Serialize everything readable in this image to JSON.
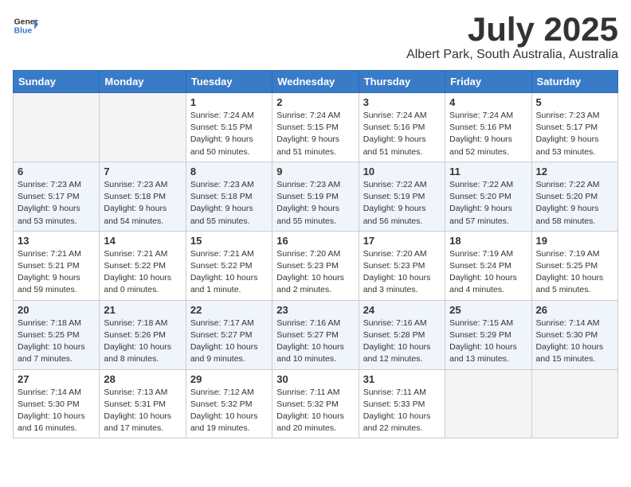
{
  "header": {
    "logo_general": "General",
    "logo_blue": "Blue",
    "month": "July 2025",
    "location": "Albert Park, South Australia, Australia"
  },
  "days_of_week": [
    "Sunday",
    "Monday",
    "Tuesday",
    "Wednesday",
    "Thursday",
    "Friday",
    "Saturday"
  ],
  "weeks": [
    [
      {
        "day": "",
        "sunrise": "",
        "sunset": "",
        "daylight": ""
      },
      {
        "day": "",
        "sunrise": "",
        "sunset": "",
        "daylight": ""
      },
      {
        "day": "1",
        "sunrise": "Sunrise: 7:24 AM",
        "sunset": "Sunset: 5:15 PM",
        "daylight": "Daylight: 9 hours and 50 minutes."
      },
      {
        "day": "2",
        "sunrise": "Sunrise: 7:24 AM",
        "sunset": "Sunset: 5:15 PM",
        "daylight": "Daylight: 9 hours and 51 minutes."
      },
      {
        "day": "3",
        "sunrise": "Sunrise: 7:24 AM",
        "sunset": "Sunset: 5:16 PM",
        "daylight": "Daylight: 9 hours and 51 minutes."
      },
      {
        "day": "4",
        "sunrise": "Sunrise: 7:24 AM",
        "sunset": "Sunset: 5:16 PM",
        "daylight": "Daylight: 9 hours and 52 minutes."
      },
      {
        "day": "5",
        "sunrise": "Sunrise: 7:23 AM",
        "sunset": "Sunset: 5:17 PM",
        "daylight": "Daylight: 9 hours and 53 minutes."
      }
    ],
    [
      {
        "day": "6",
        "sunrise": "Sunrise: 7:23 AM",
        "sunset": "Sunset: 5:17 PM",
        "daylight": "Daylight: 9 hours and 53 minutes."
      },
      {
        "day": "7",
        "sunrise": "Sunrise: 7:23 AM",
        "sunset": "Sunset: 5:18 PM",
        "daylight": "Daylight: 9 hours and 54 minutes."
      },
      {
        "day": "8",
        "sunrise": "Sunrise: 7:23 AM",
        "sunset": "Sunset: 5:18 PM",
        "daylight": "Daylight: 9 hours and 55 minutes."
      },
      {
        "day": "9",
        "sunrise": "Sunrise: 7:23 AM",
        "sunset": "Sunset: 5:19 PM",
        "daylight": "Daylight: 9 hours and 55 minutes."
      },
      {
        "day": "10",
        "sunrise": "Sunrise: 7:22 AM",
        "sunset": "Sunset: 5:19 PM",
        "daylight": "Daylight: 9 hours and 56 minutes."
      },
      {
        "day": "11",
        "sunrise": "Sunrise: 7:22 AM",
        "sunset": "Sunset: 5:20 PM",
        "daylight": "Daylight: 9 hours and 57 minutes."
      },
      {
        "day": "12",
        "sunrise": "Sunrise: 7:22 AM",
        "sunset": "Sunset: 5:20 PM",
        "daylight": "Daylight: 9 hours and 58 minutes."
      }
    ],
    [
      {
        "day": "13",
        "sunrise": "Sunrise: 7:21 AM",
        "sunset": "Sunset: 5:21 PM",
        "daylight": "Daylight: 9 hours and 59 minutes."
      },
      {
        "day": "14",
        "sunrise": "Sunrise: 7:21 AM",
        "sunset": "Sunset: 5:22 PM",
        "daylight": "Daylight: 10 hours and 0 minutes."
      },
      {
        "day": "15",
        "sunrise": "Sunrise: 7:21 AM",
        "sunset": "Sunset: 5:22 PM",
        "daylight": "Daylight: 10 hours and 1 minute."
      },
      {
        "day": "16",
        "sunrise": "Sunrise: 7:20 AM",
        "sunset": "Sunset: 5:23 PM",
        "daylight": "Daylight: 10 hours and 2 minutes."
      },
      {
        "day": "17",
        "sunrise": "Sunrise: 7:20 AM",
        "sunset": "Sunset: 5:23 PM",
        "daylight": "Daylight: 10 hours and 3 minutes."
      },
      {
        "day": "18",
        "sunrise": "Sunrise: 7:19 AM",
        "sunset": "Sunset: 5:24 PM",
        "daylight": "Daylight: 10 hours and 4 minutes."
      },
      {
        "day": "19",
        "sunrise": "Sunrise: 7:19 AM",
        "sunset": "Sunset: 5:25 PM",
        "daylight": "Daylight: 10 hours and 5 minutes."
      }
    ],
    [
      {
        "day": "20",
        "sunrise": "Sunrise: 7:18 AM",
        "sunset": "Sunset: 5:25 PM",
        "daylight": "Daylight: 10 hours and 7 minutes."
      },
      {
        "day": "21",
        "sunrise": "Sunrise: 7:18 AM",
        "sunset": "Sunset: 5:26 PM",
        "daylight": "Daylight: 10 hours and 8 minutes."
      },
      {
        "day": "22",
        "sunrise": "Sunrise: 7:17 AM",
        "sunset": "Sunset: 5:27 PM",
        "daylight": "Daylight: 10 hours and 9 minutes."
      },
      {
        "day": "23",
        "sunrise": "Sunrise: 7:16 AM",
        "sunset": "Sunset: 5:27 PM",
        "daylight": "Daylight: 10 hours and 10 minutes."
      },
      {
        "day": "24",
        "sunrise": "Sunrise: 7:16 AM",
        "sunset": "Sunset: 5:28 PM",
        "daylight": "Daylight: 10 hours and 12 minutes."
      },
      {
        "day": "25",
        "sunrise": "Sunrise: 7:15 AM",
        "sunset": "Sunset: 5:29 PM",
        "daylight": "Daylight: 10 hours and 13 minutes."
      },
      {
        "day": "26",
        "sunrise": "Sunrise: 7:14 AM",
        "sunset": "Sunset: 5:30 PM",
        "daylight": "Daylight: 10 hours and 15 minutes."
      }
    ],
    [
      {
        "day": "27",
        "sunrise": "Sunrise: 7:14 AM",
        "sunset": "Sunset: 5:30 PM",
        "daylight": "Daylight: 10 hours and 16 minutes."
      },
      {
        "day": "28",
        "sunrise": "Sunrise: 7:13 AM",
        "sunset": "Sunset: 5:31 PM",
        "daylight": "Daylight: 10 hours and 17 minutes."
      },
      {
        "day": "29",
        "sunrise": "Sunrise: 7:12 AM",
        "sunset": "Sunset: 5:32 PM",
        "daylight": "Daylight: 10 hours and 19 minutes."
      },
      {
        "day": "30",
        "sunrise": "Sunrise: 7:11 AM",
        "sunset": "Sunset: 5:32 PM",
        "daylight": "Daylight: 10 hours and 20 minutes."
      },
      {
        "day": "31",
        "sunrise": "Sunrise: 7:11 AM",
        "sunset": "Sunset: 5:33 PM",
        "daylight": "Daylight: 10 hours and 22 minutes."
      },
      {
        "day": "",
        "sunrise": "",
        "sunset": "",
        "daylight": ""
      },
      {
        "day": "",
        "sunrise": "",
        "sunset": "",
        "daylight": ""
      }
    ]
  ]
}
